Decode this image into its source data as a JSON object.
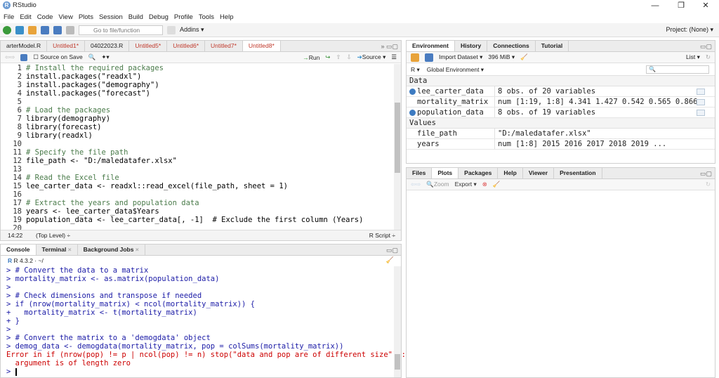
{
  "window": {
    "title": "RStudio",
    "minimize": "—",
    "restore": "❐",
    "close": "✕"
  },
  "menu": [
    "File",
    "Edit",
    "Code",
    "View",
    "Plots",
    "Session",
    "Build",
    "Debug",
    "Profile",
    "Tools",
    "Help"
  ],
  "toolbar": {
    "goto_placeholder": "Go to file/function",
    "addins": "Addins ▾",
    "project": "Project: (None) ▾"
  },
  "source": {
    "tabs": [
      {
        "label": "arterModel.R",
        "modified": false
      },
      {
        "label": "Untitled1*",
        "modified": true
      },
      {
        "label": "04022023.R",
        "modified": false
      },
      {
        "label": "Untitled5*",
        "modified": true
      },
      {
        "label": "Untitled6*",
        "modified": true
      },
      {
        "label": "Untitled7*",
        "modified": true
      },
      {
        "label": "Untitled8*",
        "modified": true,
        "active": true
      }
    ],
    "source_on_save": "Source on Save",
    "run": "Run",
    "source_btn": "Source",
    "lines": [
      {
        "n": "1",
        "t": "# Install the required packages",
        "c": true
      },
      {
        "n": "2",
        "t": "install.packages(\"readxl\")"
      },
      {
        "n": "3",
        "t": "install.packages(\"demography\")"
      },
      {
        "n": "4",
        "t": "install.packages(\"forecast\")"
      },
      {
        "n": "5",
        "t": ""
      },
      {
        "n": "6",
        "t": "# Load the packages",
        "c": true
      },
      {
        "n": "7",
        "t": "library(demography)"
      },
      {
        "n": "8",
        "t": "library(forecast)"
      },
      {
        "n": "9",
        "t": "library(readxl)"
      },
      {
        "n": "10",
        "t": ""
      },
      {
        "n": "11",
        "t": "# Specify the file path",
        "c": true
      },
      {
        "n": "12",
        "t": "file_path <- \"D:/maledatafer.xlsx\""
      },
      {
        "n": "13",
        "t": ""
      },
      {
        "n": "14",
        "t": "# Read the Excel file",
        "c": true
      },
      {
        "n": "15",
        "t": "lee_carter_data <- readxl::read_excel(file_path, sheet = 1)"
      },
      {
        "n": "16",
        "t": ""
      },
      {
        "n": "17",
        "t": "# Extract the years and population data",
        "c": true
      },
      {
        "n": "18",
        "t": "years <- lee_carter_data$Years"
      },
      {
        "n": "19",
        "t": "population_data <- lee_carter_data[, -1]  # Exclude the first column (Years)"
      },
      {
        "n": "20",
        "t": ""
      }
    ],
    "status": {
      "position": "14:22",
      "scope": "(Top Level) ÷",
      "type": "R Script ÷"
    }
  },
  "console": {
    "tabs": [
      "Console",
      "Terminal",
      "Background Jobs"
    ],
    "version": "R 4.3.2 · ~/",
    "lines": [
      {
        "t": "> # Convert the data to a matrix"
      },
      {
        "t": "> mortality_matrix <- as.matrix(population_data)"
      },
      {
        "t": ">"
      },
      {
        "t": "> # Check dimensions and transpose if needed"
      },
      {
        "t": "> if (nrow(mortality_matrix) < ncol(mortality_matrix)) {"
      },
      {
        "t": "+   mortality_matrix <- t(mortality_matrix)"
      },
      {
        "t": "+ }"
      },
      {
        "t": ">"
      },
      {
        "t": "> # Convert the matrix to a 'demogdata' object"
      },
      {
        "t": "> demog_data <- demogdata(mortality_matrix, pop = colSums(mortality_matrix))"
      },
      {
        "t": "Error in if (nrow(pop) != p | ncol(pop) != n) stop(\"data and pop are of different size\") :",
        "err": true
      },
      {
        "t": "  argument is of length zero",
        "err": true
      },
      {
        "t": "> "
      }
    ]
  },
  "environment": {
    "tabs": [
      "Environment",
      "History",
      "Connections",
      "Tutorial"
    ],
    "import_dataset": "Import Dataset ▾",
    "memory": "396 MiB ▾",
    "list_view": "List ▾",
    "lang": "R ▾",
    "scope": "Global Environment ▾",
    "data_header": "Data",
    "data": [
      {
        "name": "lee_carter_data",
        "value": "8 obs. of 20 variables",
        "expandable": true
      },
      {
        "name": "mortality_matrix",
        "value": "num [1:19, 1:8] 4.341 1.427 0.542 0.565 0.866…",
        "expandable": false
      },
      {
        "name": "population_data",
        "value": "8 obs. of 19 variables",
        "expandable": true
      }
    ],
    "values_header": "Values",
    "values": [
      {
        "name": "file_path",
        "value": "\"D:/maledatafer.xlsx\""
      },
      {
        "name": "years",
        "value": "num [1:8] 2015 2016 2017 2018 2019 ..."
      }
    ]
  },
  "files": {
    "tabs": [
      "Files",
      "Plots",
      "Packages",
      "Help",
      "Viewer",
      "Presentation"
    ],
    "active": "Plots",
    "zoom": "Zoom",
    "export": "Export ▾"
  }
}
